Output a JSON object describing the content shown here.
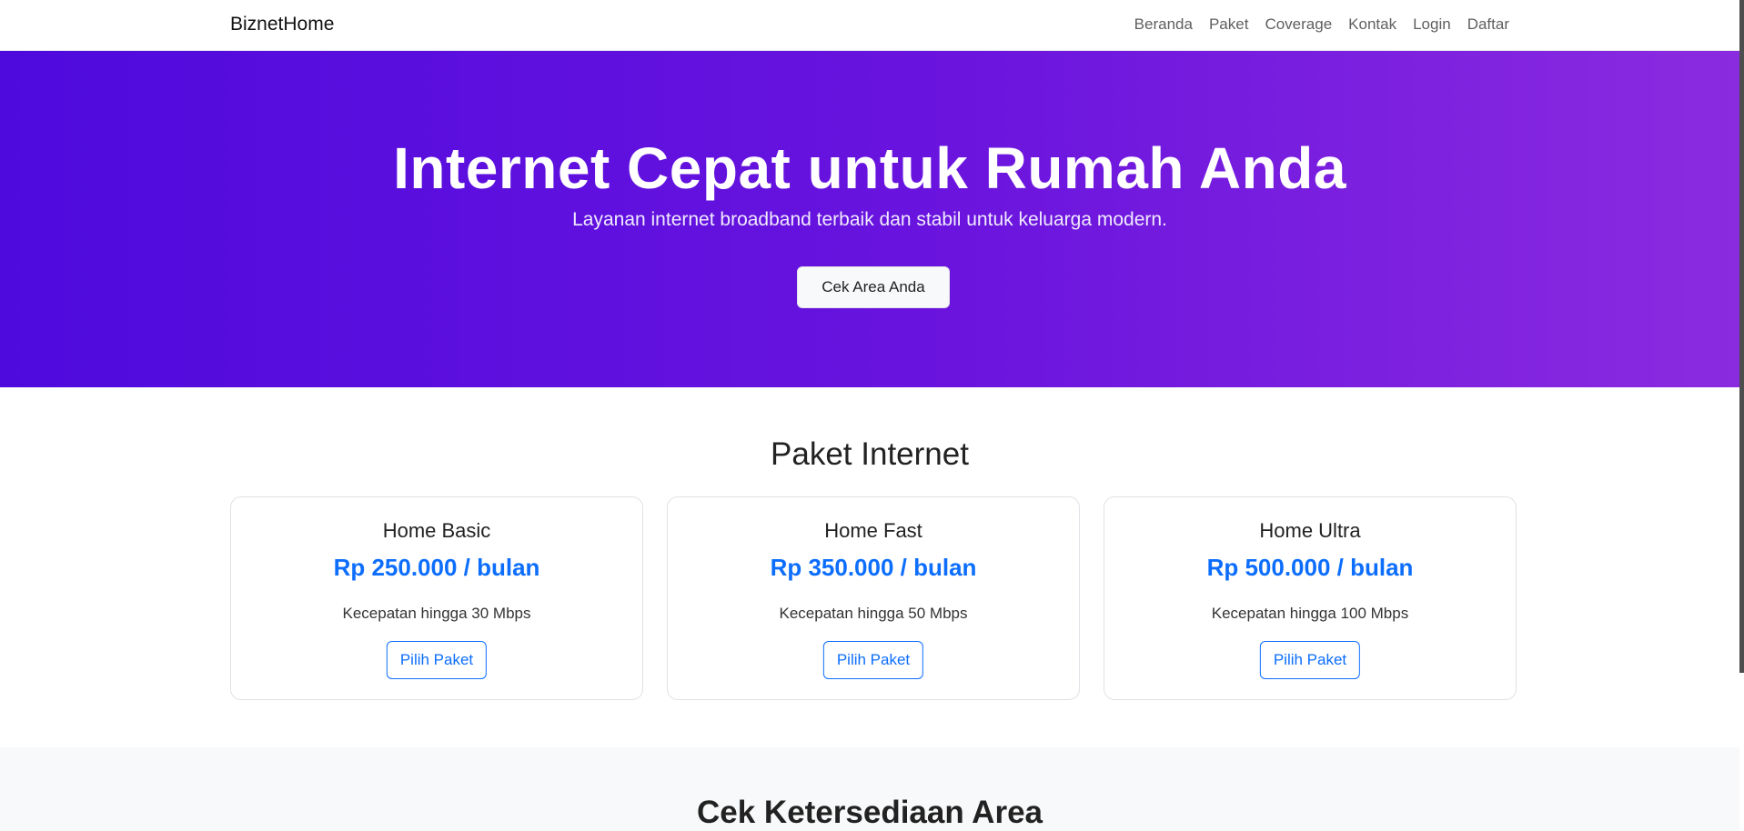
{
  "navbar": {
    "brand": "BiznetHome",
    "links": [
      "Beranda",
      "Paket",
      "Coverage",
      "Kontak",
      "Login",
      "Daftar"
    ]
  },
  "hero": {
    "title": "Internet Cepat untuk Rumah Anda",
    "subtitle": "Layanan internet broadband terbaik dan stabil untuk keluarga modern.",
    "cta": "Cek Area Anda"
  },
  "packages": {
    "title": "Paket Internet",
    "items": [
      {
        "name": "Home Basic",
        "price": "Rp 250.000 / bulan",
        "speed": "Kecepatan hingga 30 Mbps",
        "button": "Pilih Paket"
      },
      {
        "name": "Home Fast",
        "price": "Rp 350.000 / bulan",
        "speed": "Kecepatan hingga 50 Mbps",
        "button": "Pilih Paket"
      },
      {
        "name": "Home Ultra",
        "price": "Rp 500.000 / bulan",
        "speed": "Kecepatan hingga 100 Mbps",
        "button": "Pilih Paket"
      }
    ]
  },
  "coverage": {
    "title": "Cek Ketersediaan Area"
  },
  "colors": {
    "hero_gradient_start": "#4e0add",
    "hero_gradient_end": "#8b2be0",
    "accent": "#0d6efd"
  }
}
